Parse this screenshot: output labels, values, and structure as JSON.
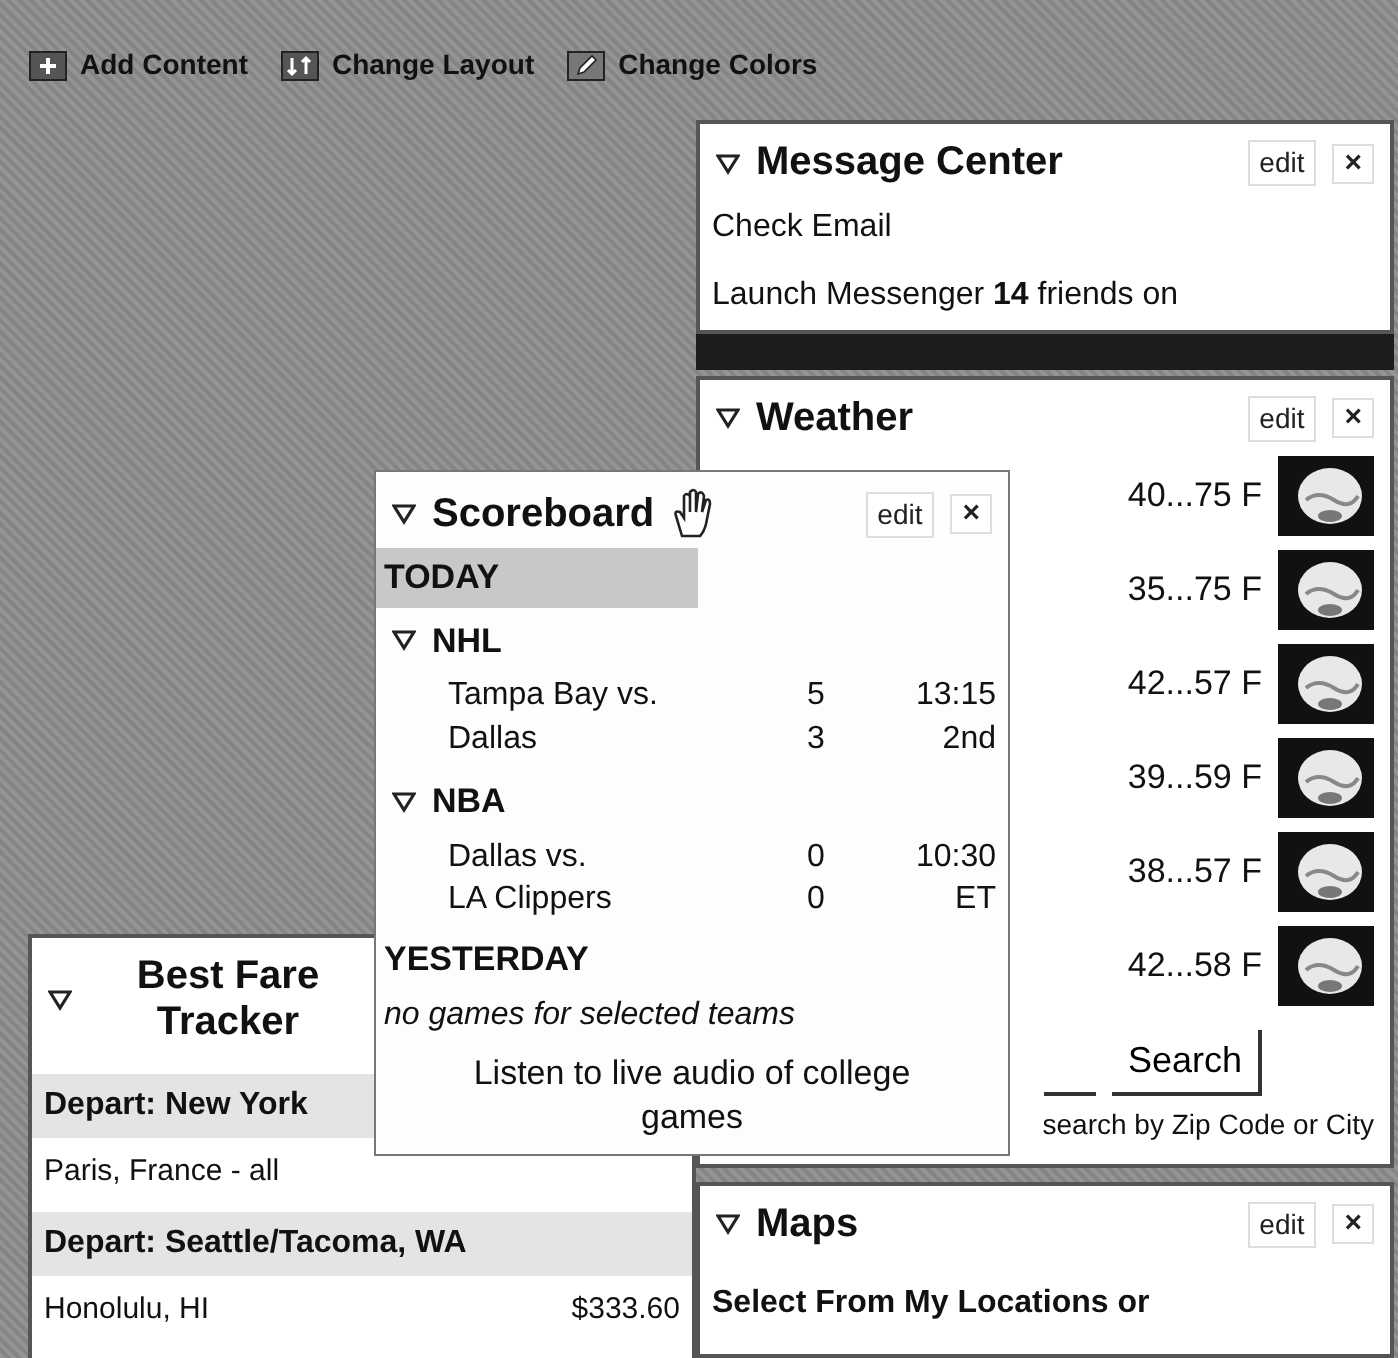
{
  "toolbar": [
    {
      "label": "Add Content",
      "kind": "add"
    },
    {
      "label": "Change Layout",
      "kind": "layout"
    },
    {
      "label": "Change Colors",
      "kind": "colors"
    }
  ],
  "message_center": {
    "title": "Message Center",
    "expanded": true,
    "edit": "edit",
    "close": "×",
    "rows": [
      "Check Email",
      "Launch Messenger  **14** friends on"
    ]
  },
  "weather": {
    "title": "Weather",
    "expanded": true,
    "edit": "edit",
    "close": "×",
    "rows": [
      {
        "temp": "40...75 F"
      },
      {
        "temp": "35...75 F"
      },
      {
        "temp": "42...57 F"
      },
      {
        "temp": "39...59 F"
      },
      {
        "temp": "38...57 F"
      },
      {
        "temp": "42...58 F"
      }
    ],
    "search_button": "Search",
    "hint": "search by Zip Code or City"
  },
  "maps": {
    "title": "Maps",
    "expanded": true,
    "edit": "edit",
    "close": "×",
    "text": "Select From My Locations or"
  },
  "best_fare": {
    "title": "Best Fare Tracker",
    "expanded": true,
    "groups": [
      {
        "depart": "Depart: New York",
        "fares": [
          {
            "route": "Paris, France - all"
          }
        ]
      },
      {
        "depart": "Depart: Seattle/Tacoma, WA",
        "fares": [
          {
            "route": "Honolulu, HI",
            "price": "$333.60"
          }
        ]
      }
    ]
  },
  "scoreboard": {
    "title": "Scoreboard",
    "expanded": true,
    "edit": "edit",
    "close": "×",
    "days": [
      {
        "label": "TODAY",
        "highlighted": true,
        "leagues": [
          {
            "name": "NHL",
            "expanded": true,
            "games": [
              {
                "lines": [
                  {
                    "team": "Tampa Bay vs.",
                    "score": "5",
                    "status": "13:15"
                  },
                  {
                    "team": "Dallas",
                    "score": "3",
                    "status": "2nd"
                  }
                ]
              }
            ]
          },
          {
            "name": "NBA",
            "expanded": true,
            "games": [
              {
                "lines": [
                  {
                    "team": "Dallas vs.",
                    "score": "0",
                    "status": "10:30"
                  },
                  {
                    "team": "LA Clippers",
                    "score": "0",
                    "status": "ET"
                  }
                ]
              }
            ]
          }
        ]
      },
      {
        "label": "YESTERDAY",
        "highlighted": false,
        "note": "no games for selected teams"
      }
    ],
    "footer": "Listen to live audio of college games"
  }
}
